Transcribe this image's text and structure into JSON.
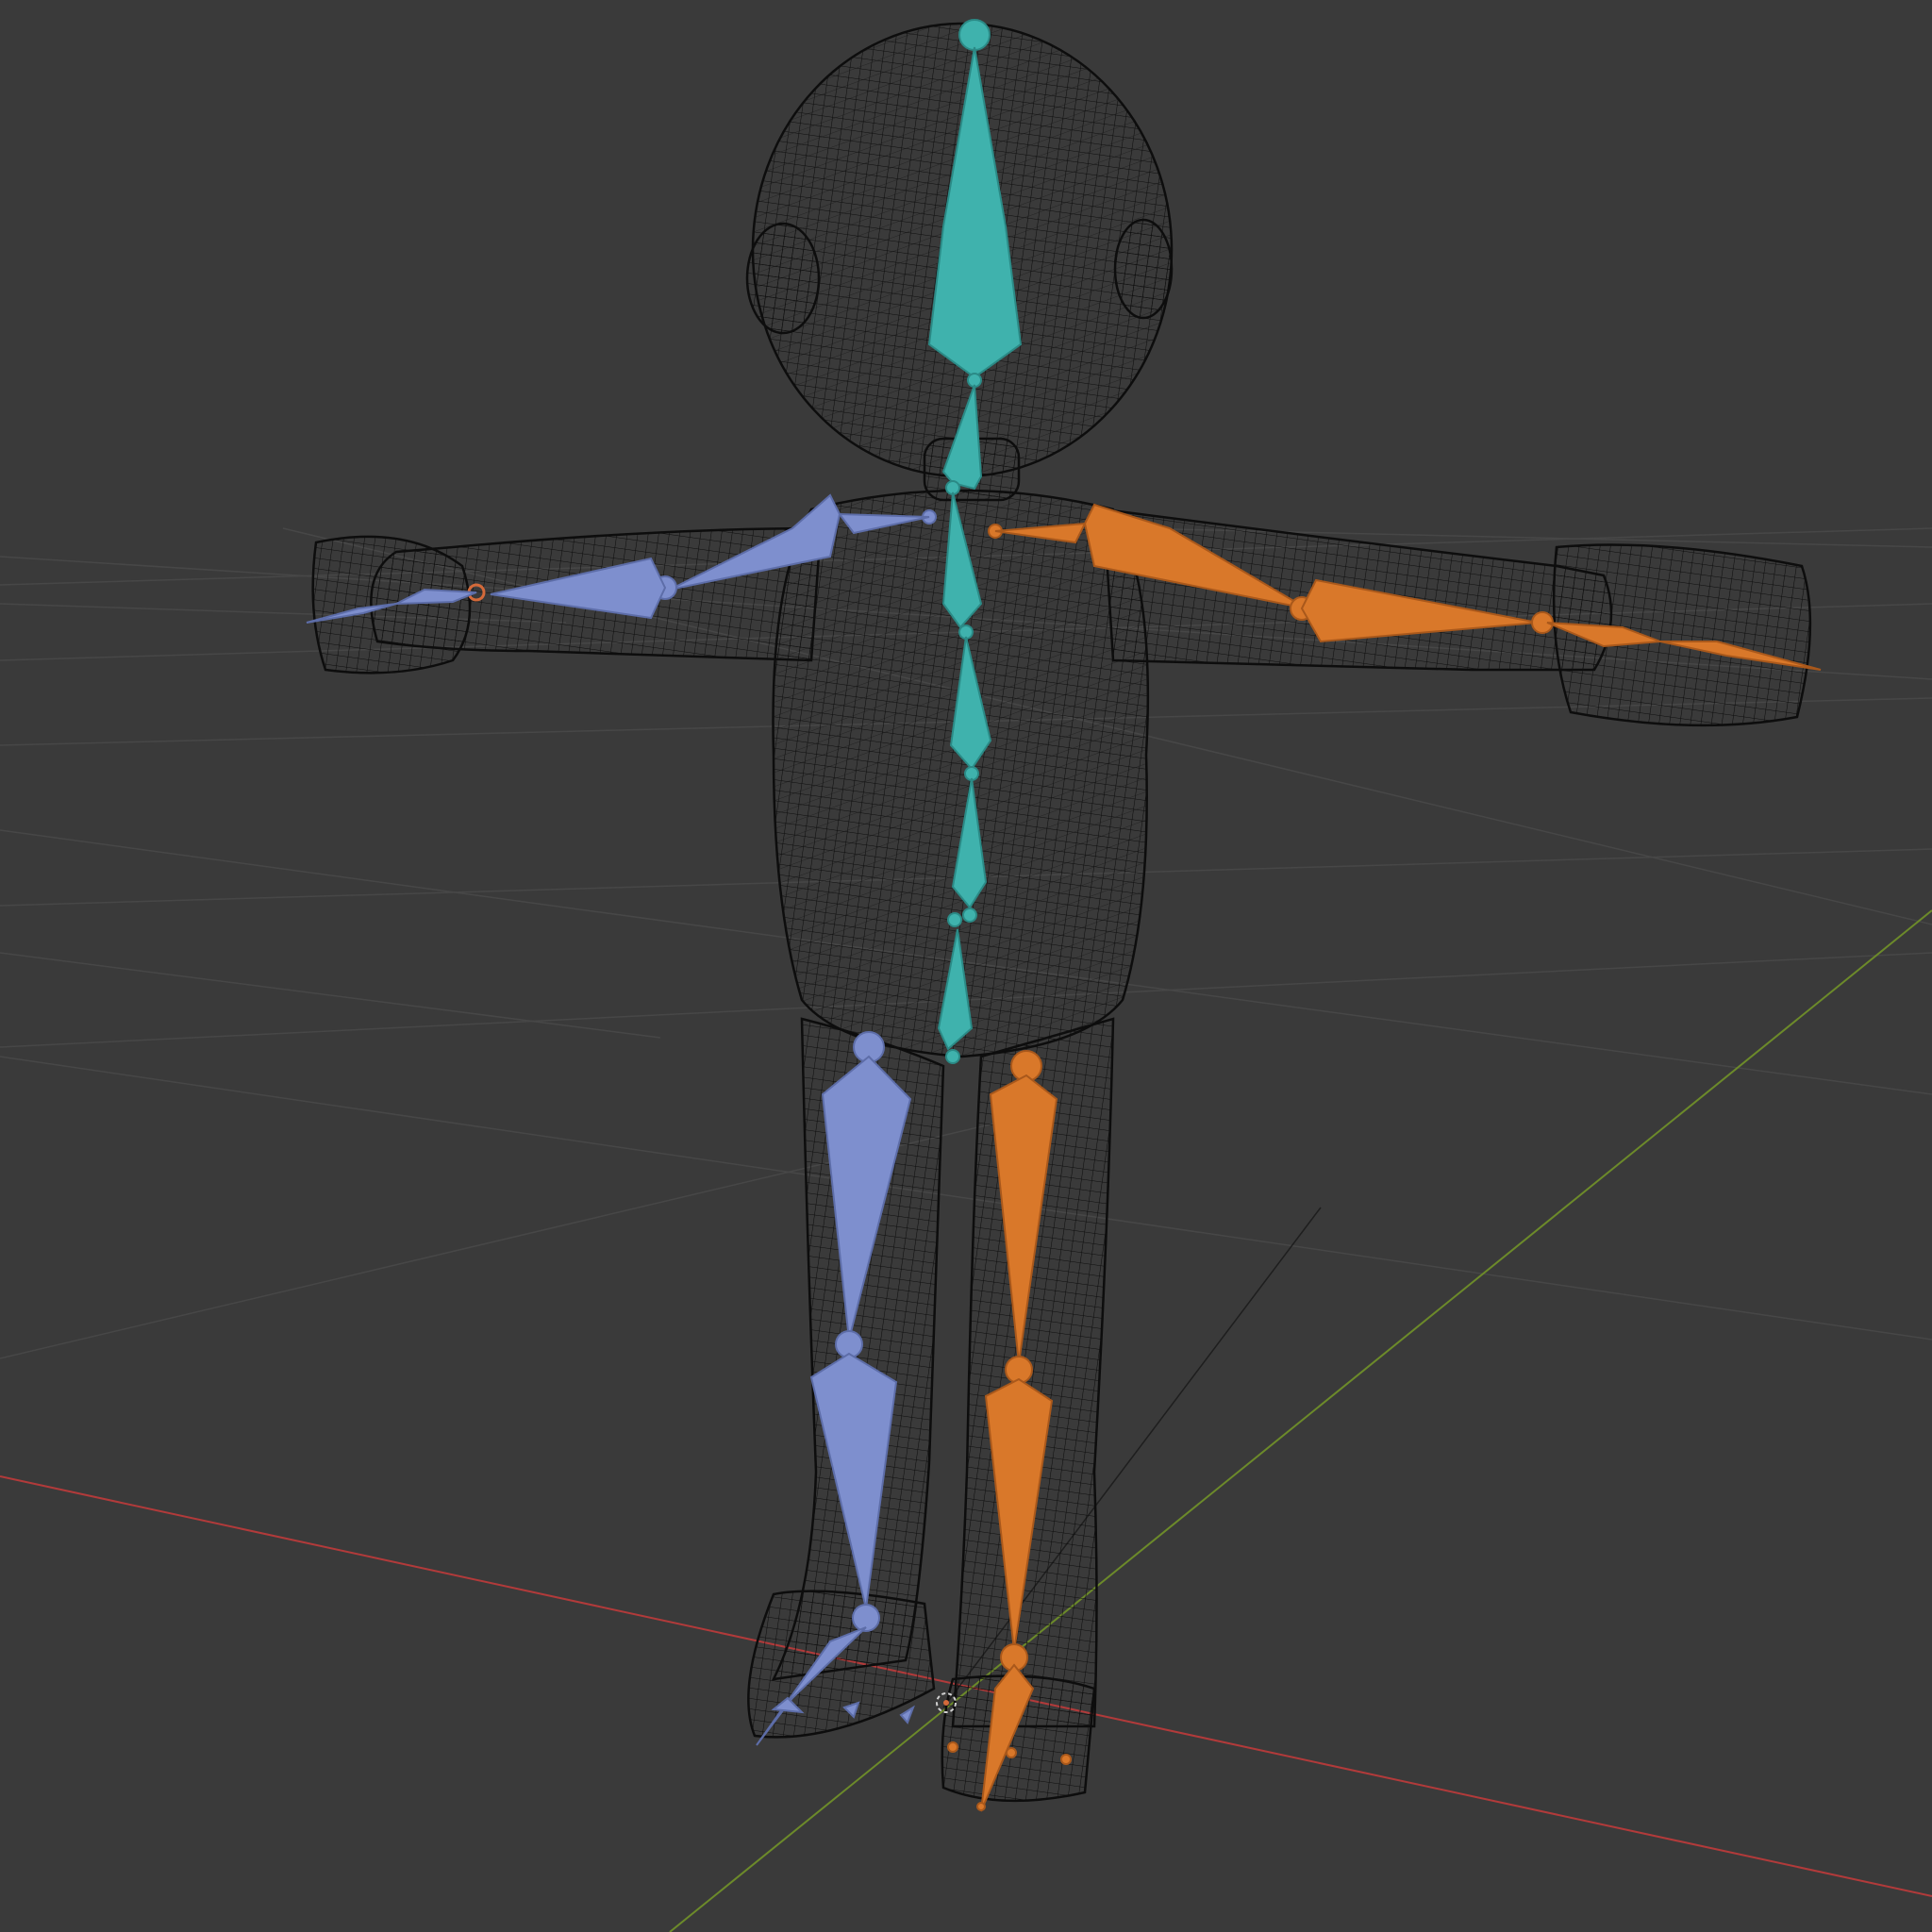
{
  "viewport": {
    "mode": "wireframe",
    "background": "#3a3a3a",
    "grid_color": "#4a4a4a",
    "axis_x_color": "#b23a3a",
    "axis_y_color": "#6c8a2a",
    "axis_z_color": "#1e1e1e"
  },
  "mesh": {
    "name": "character-body-wireframe",
    "wire_color": "#0d0d0d"
  },
  "armature": {
    "center_color": "#3fb2ad",
    "left_color": "#7e8fce",
    "right_color": "#d9782a",
    "bones_center": [
      "head",
      "neck",
      "spine-upper",
      "spine-mid",
      "spine-lower",
      "spine-base",
      "hips"
    ],
    "bones_left": [
      "shoulder-l",
      "upper-arm-l",
      "forearm-l",
      "hand-l",
      "thigh-l",
      "shin-l",
      "foot-l",
      "toe-l"
    ],
    "bones_right": [
      "shoulder-r",
      "upper-arm-r",
      "forearm-r",
      "hand-r",
      "thigh-r",
      "shin-r",
      "foot-r",
      "toe-r"
    ]
  }
}
